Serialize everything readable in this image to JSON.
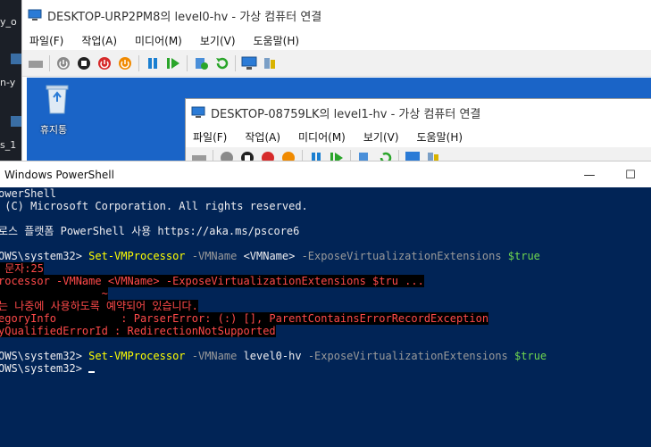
{
  "desktop": {
    "side_texts": [
      "y_o",
      "n-y",
      "s_1"
    ],
    "recycle_label": "휴지통"
  },
  "outer_vm": {
    "title": "DESKTOP-URP2PM8의 level0-hv - 가상 컴퓨터 연결",
    "menu": [
      "파일(F)",
      "작업(A)",
      "미디어(M)",
      "보기(V)",
      "도움말(H)"
    ]
  },
  "inner_vm": {
    "title": "DESKTOP-08759LK의 level1-hv - 가상 컴퓨터 연결",
    "menu": [
      "파일(F)",
      "작업(A)",
      "미디어(M)",
      "보기(V)",
      "도움말(H)"
    ]
  },
  "powershell": {
    "title": "Windows PowerShell",
    "minimize": "—",
    "maximize": "☐",
    "lines": {
      "l1": "owerShell",
      "l2": " (C) Microsoft Corporation. All rights reserved.",
      "l3": "로스 플랫폼 PowerShell 사용 https://aka.ms/pscore6",
      "prompt1": "OWS\\system32> ",
      "cmd1": "Set-VMProcessor",
      "p1": " -VMName ",
      "a1": "<VMName>",
      "p2": " -ExposeVirtualizationExtensions ",
      "v1": "$true",
      "err1": " 문자:25",
      "err2": "rocessor -VMName <VMName> -ExposeVirtualizationExtensions $tru ...",
      "err3": "                ~",
      "err4": "는 나중에 사용하도록 예약되어 있습니다.",
      "err5": "egoryInfo          : ParserError: (:) [], ParentContainsErrorRecordException",
      "err6": "yQualifiedErrorId : RedirectionNotSupported",
      "prompt2": "OWS\\system32> ",
      "cmd2": "Set-VMProcessor",
      "p3": " -VMName ",
      "a2": "level0-hv",
      "p4": " -ExposeVirtualizationExtensions ",
      "v2": "$true",
      "prompt3": "OWS\\system32> "
    }
  }
}
